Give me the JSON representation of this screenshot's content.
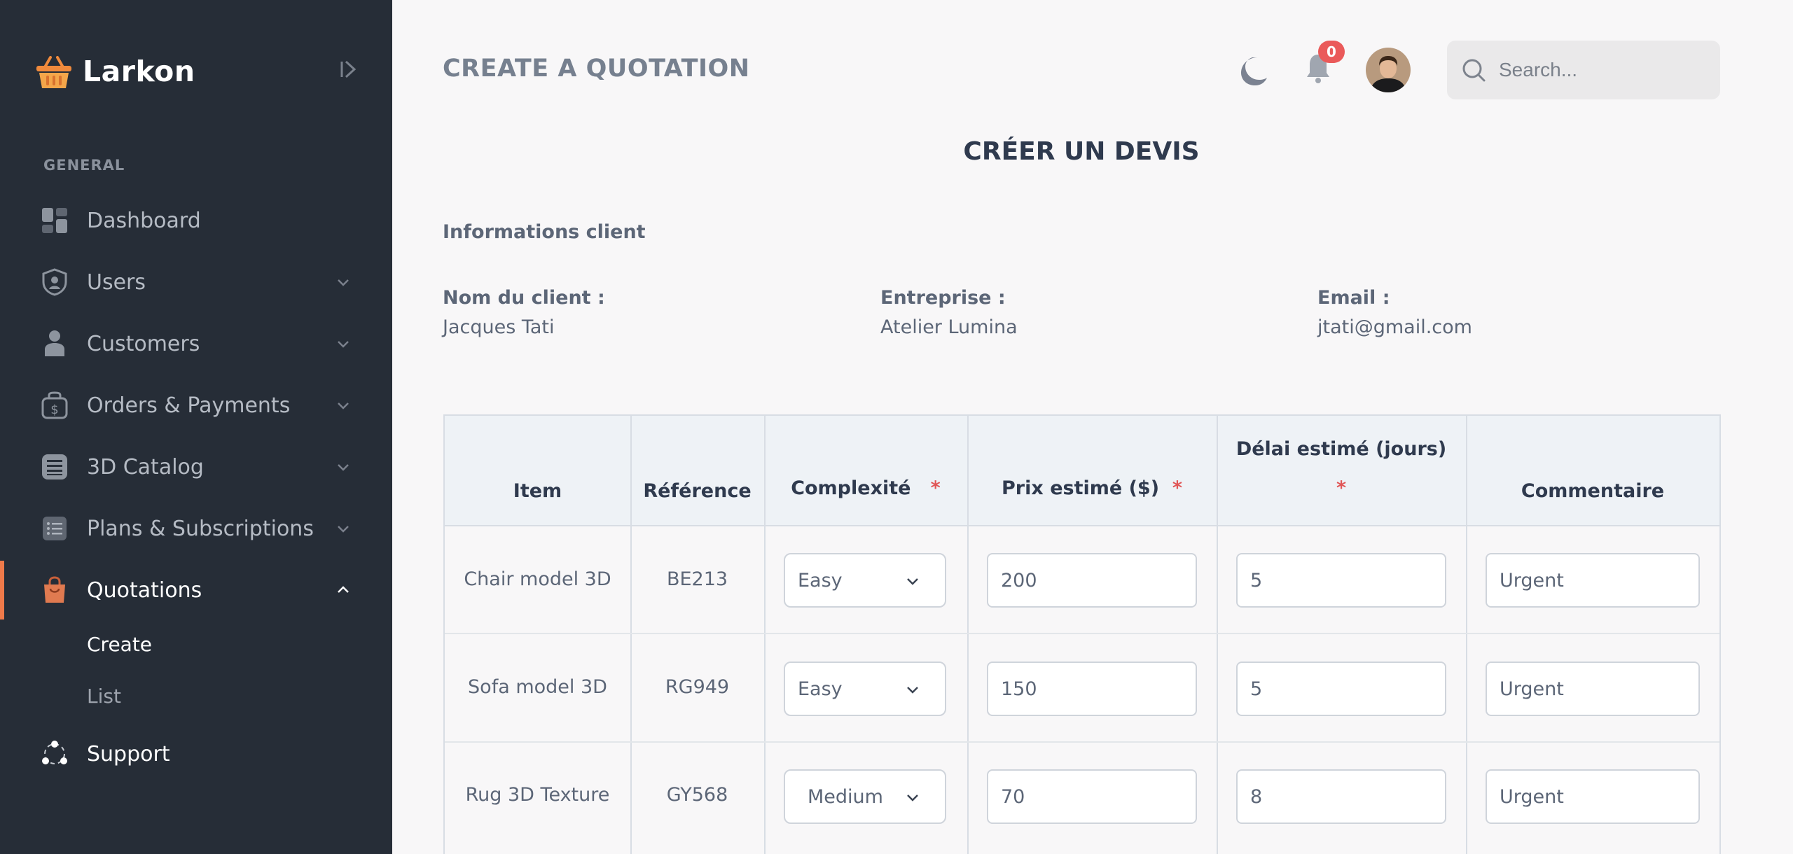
{
  "app": {
    "name": "Larkon"
  },
  "sidebar": {
    "section_label": "GENERAL",
    "items": [
      {
        "label": "Dashboard",
        "icon": "dashboard-icon"
      },
      {
        "label": "Users",
        "icon": "shield-user-icon"
      },
      {
        "label": "Customers",
        "icon": "person-icon"
      },
      {
        "label": "Orders & Payments",
        "icon": "dollar-bag-icon"
      },
      {
        "label": "3D Catalog",
        "icon": "catalog-icon"
      },
      {
        "label": "Plans & Subscriptions",
        "icon": "list-icon"
      },
      {
        "label": "Quotations",
        "icon": "shopping-bag-icon"
      },
      {
        "label": "Support",
        "icon": "support-icon"
      }
    ],
    "quotations_sub": [
      {
        "label": "Create"
      },
      {
        "label": "List"
      }
    ]
  },
  "header": {
    "page_title": "CREATE A QUOTATION",
    "notification_count": "0",
    "search_placeholder": "Search..."
  },
  "form": {
    "title": "CRÉER UN DEVIS",
    "section_title": "Informations client",
    "client": {
      "name_label": "Nom du client :",
      "name_value": "Jacques Tati",
      "company_label": "Entreprise :",
      "company_value": "Atelier Lumina",
      "email_label": "Email :",
      "email_value": "jtati@gmail.com"
    }
  },
  "table": {
    "headers": {
      "item": "Item",
      "reference": "Référence",
      "complexity": "Complexité",
      "price": "Prix estimé ($)",
      "delay": "Délai estimé (jours)",
      "comment": "Commentaire",
      "required_mark": "*"
    },
    "rows": [
      {
        "item": "Chair model 3D",
        "reference": "BE213",
        "complexity": "Easy",
        "price": "200",
        "delay": "5",
        "comment": "Urgent"
      },
      {
        "item": "Sofa model 3D",
        "reference": "RG949",
        "complexity": "Easy",
        "price": "150",
        "delay": "5",
        "comment": "Urgent"
      },
      {
        "item": "Rug 3D Texture",
        "reference": "GY568",
        "complexity": "Medium",
        "price": "70",
        "delay": "8",
        "comment": "Urgent"
      }
    ]
  },
  "colors": {
    "sidebar_bg": "#262d37",
    "accent": "#ef7a4a",
    "page_bg": "#f8f7f8",
    "required": "#e05656"
  }
}
